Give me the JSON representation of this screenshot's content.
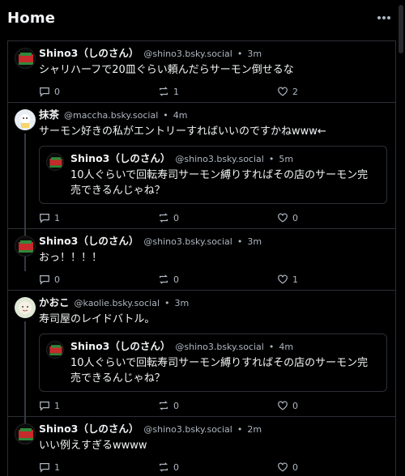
{
  "header": {
    "title": "Home",
    "more_icon": "more-horizontal-icon"
  },
  "posts": [
    {
      "author": "Shino3（しのさん）",
      "handle": "@shino3.bsky.social",
      "separator": "•",
      "time": "3m",
      "text": "シャリハーフで20皿ぐらい頼んだらサーモン倒せるな",
      "replies": "0",
      "reposts": "1",
      "likes": "2"
    },
    {
      "author": "抹茶",
      "handle": "@maccha.bsky.social",
      "separator": "•",
      "time": "4m",
      "text": "サーモン好きの私がエントリーすればいいのですかねwww←",
      "quote": {
        "author": "Shino3（しのさん）",
        "handle": "@shino3.bsky.social",
        "separator": "•",
        "time": "5m",
        "text": "10人ぐらいで回転寿司サーモン縛りすればその店のサーモン完売できるんじゃね？"
      },
      "replies": "1",
      "reposts": "0",
      "likes": "0"
    },
    {
      "author": "Shino3（しのさん）",
      "handle": "@shino3.bsky.social",
      "separator": "•",
      "time": "3m",
      "text": "おっ！！！！",
      "replies": "0",
      "reposts": "0",
      "likes": "1"
    },
    {
      "author": "かおこ",
      "handle": "@kaolie.bsky.social",
      "separator": "•",
      "time": "3m",
      "text": "寿司屋のレイドバトル。",
      "quote": {
        "author": "Shino3（しのさん）",
        "handle": "@shino3.bsky.social",
        "separator": "•",
        "time": "4m",
        "text": "10人ぐらいで回転寿司サーモン縛りすればその店のサーモン完売できるんじゃね？"
      },
      "replies": "1",
      "reposts": "0",
      "likes": "0"
    },
    {
      "author": "Shino3（しのさん）",
      "handle": "@shino3.bsky.social",
      "separator": "•",
      "time": "2m",
      "text": "いい例えすぎるwwww",
      "replies": "1",
      "reposts": "0",
      "likes": "0"
    }
  ]
}
